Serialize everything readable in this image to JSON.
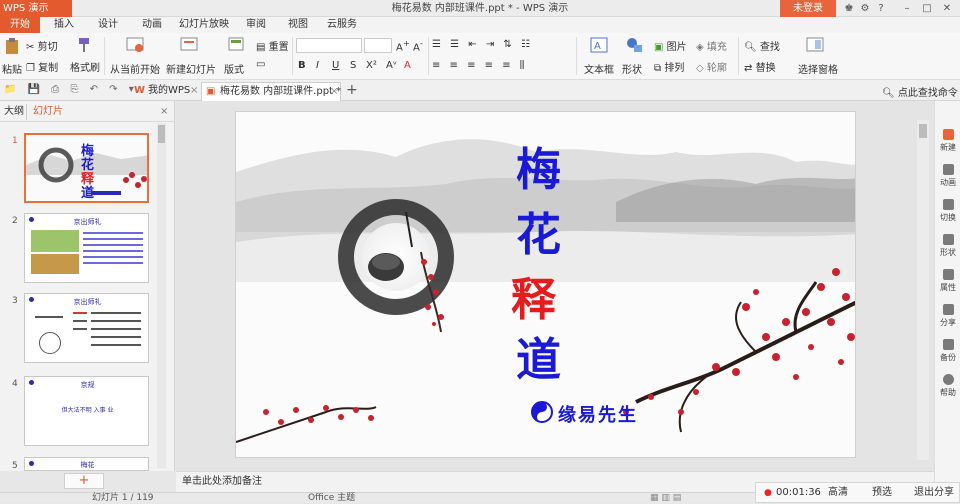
{
  "app": {
    "name": "WPS 演示",
    "window_title": "梅花易数 内部班课件.ppt * - WPS 演示",
    "login": "未登录"
  },
  "menu": [
    "开始",
    "插入",
    "设计",
    "动画",
    "幻灯片放映",
    "审阅",
    "视图",
    "云服务"
  ],
  "ribbon": {
    "paste": "粘贴",
    "cut": "剪切",
    "copy": "复制",
    "format_painter": "格式刷",
    "from_current": "从当前开始",
    "new_slide": "新建幻灯片",
    "layout": "版式",
    "reset": "重置",
    "text_box": "文本框",
    "shape": "形状",
    "picture": "图片",
    "fill": "填充",
    "arrange": "排列",
    "outline": "轮廓",
    "find": "查找",
    "replace": "替换",
    "selection_pane": "选择窗格"
  },
  "doctabs": {
    "home": "我的WPS",
    "doc": "梅花易数 内部班课件.ppt *",
    "add": "+"
  },
  "search": {
    "label": "点此查找命令"
  },
  "left_panel": {
    "tab_outline": "大纲",
    "tab_slides": "幻灯片",
    "thumb_nums": [
      "1",
      "2",
      "3",
      "4",
      "5"
    ],
    "thumb2_title": "京出师礼",
    "thumb3_title": "京出师礼",
    "thumb4_title": "京规",
    "thumb4_text": "但大法不明 入事 业",
    "thumb5_title": "梅花"
  },
  "slide": {
    "title_chars": [
      "梅",
      "花",
      "释",
      "道"
    ],
    "title_colors": [
      "#1a1ad6",
      "#1a1ad6",
      "#e51c1c",
      "#1a1ad6"
    ],
    "author": "缘易先生"
  },
  "notes": {
    "placeholder": "单击此处添加备注"
  },
  "right_sidebar": [
    "新建",
    "动画",
    "切换",
    "形状",
    "属性",
    "分享",
    "备份",
    "帮助"
  ],
  "status": {
    "slide_counter": "幻灯片 1 / 119",
    "theme": "Office 主题"
  },
  "recorder": {
    "time": "00:01:36",
    "hd": "高清",
    "preview": "预选",
    "exit_share": "退出分享"
  }
}
